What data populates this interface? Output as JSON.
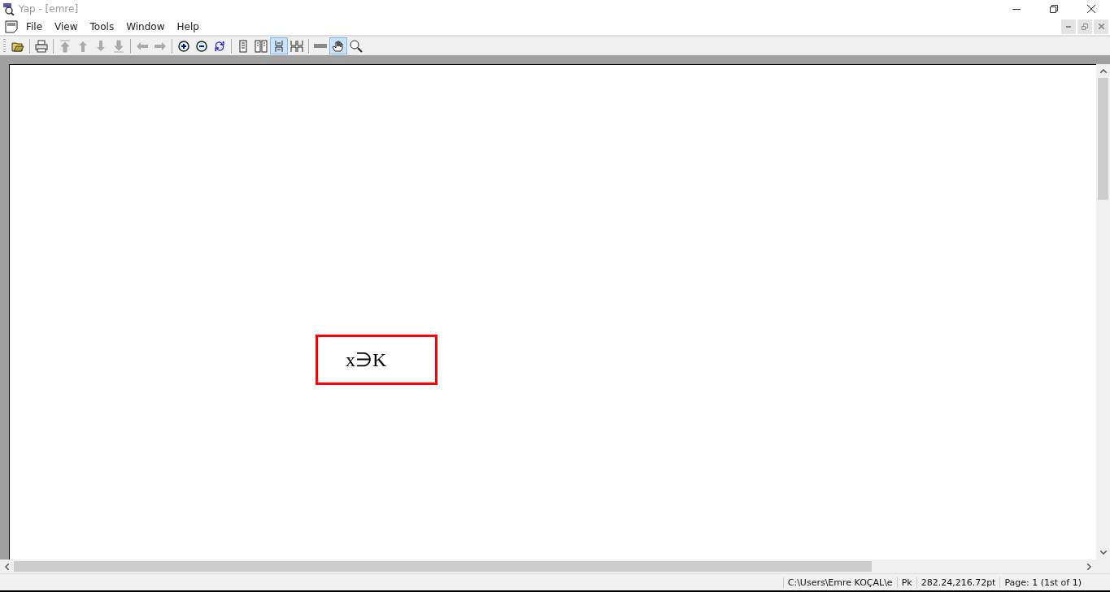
{
  "window": {
    "title": "Yap - [emre]"
  },
  "menu": [
    "File",
    "View",
    "Tools",
    "Window",
    "Help"
  ],
  "toolbar": [
    {
      "kind": "open",
      "disabled": false,
      "selected": false
    },
    {
      "kind": "sep"
    },
    {
      "kind": "print",
      "disabled": false,
      "selected": false
    },
    {
      "kind": "sep"
    },
    {
      "kind": "first",
      "disabled": true,
      "selected": false
    },
    {
      "kind": "up",
      "disabled": true,
      "selected": false
    },
    {
      "kind": "down",
      "disabled": true,
      "selected": false
    },
    {
      "kind": "last",
      "disabled": true,
      "selected": false
    },
    {
      "kind": "sep"
    },
    {
      "kind": "back",
      "disabled": true,
      "selected": false
    },
    {
      "kind": "forward",
      "disabled": true,
      "selected": false
    },
    {
      "kind": "sep"
    },
    {
      "kind": "zoomin",
      "disabled": false,
      "selected": false
    },
    {
      "kind": "zoomout",
      "disabled": false,
      "selected": false
    },
    {
      "kind": "refresh",
      "disabled": false,
      "selected": false
    },
    {
      "kind": "sep"
    },
    {
      "kind": "single",
      "disabled": false,
      "selected": false
    },
    {
      "kind": "double",
      "disabled": false,
      "selected": false
    },
    {
      "kind": "continuous",
      "disabled": false,
      "selected": true
    },
    {
      "kind": "continuousdouble",
      "disabled": false,
      "selected": false
    },
    {
      "kind": "sep"
    },
    {
      "kind": "ruler",
      "disabled": false,
      "selected": false
    },
    {
      "kind": "hand",
      "disabled": false,
      "selected": true
    },
    {
      "kind": "magnifier",
      "disabled": false,
      "selected": false
    }
  ],
  "document": {
    "formula": "x∋K"
  },
  "status_bar": [
    "C:\\Users\\Emre KOÇAL\\e",
    "Pk",
    "282.24,216.72pt",
    "Page: 1 (1st of 1)"
  ]
}
